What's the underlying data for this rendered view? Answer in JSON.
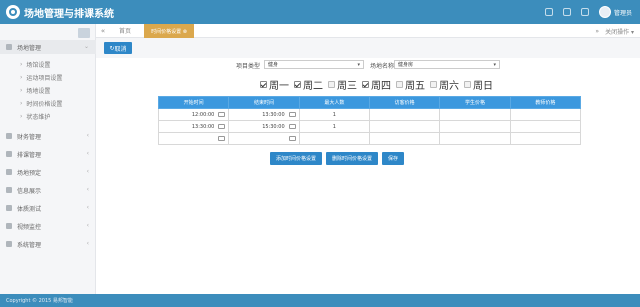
{
  "app": {
    "title": "场地管理与排课系统",
    "user": "管理员"
  },
  "topbar": {
    "icons": [
      "grid-icon",
      "bell-icon",
      "help-icon"
    ]
  },
  "tabs": {
    "home": "首页",
    "active": "时间价格设置 ⊗",
    "more": "关闭操作 ▾"
  },
  "sidebar": {
    "sections": [
      {
        "label": "场地管理",
        "icon": "venue-icon",
        "expanded": true,
        "chev": "⌄"
      },
      {
        "label": "财务管理",
        "icon": "money-icon",
        "chev": "‹"
      },
      {
        "label": "排课管理",
        "icon": "schedule-icon",
        "chev": "‹"
      },
      {
        "label": "场地预定",
        "icon": "check-icon",
        "chev": "‹"
      },
      {
        "label": "信息展示",
        "icon": "info-icon",
        "chev": "‹"
      },
      {
        "label": "体质测试",
        "icon": "heart-icon",
        "chev": "‹"
      },
      {
        "label": "视频监控",
        "icon": "video-icon",
        "chev": "‹"
      },
      {
        "label": "系统管理",
        "icon": "gear-icon",
        "chev": "‹"
      }
    ],
    "sub": [
      "场馆设置",
      "运动项目设置",
      "场地设置",
      "时间价格设置",
      "状态维护"
    ]
  },
  "toolbar": {
    "cancel": "取消"
  },
  "form": {
    "project_label": "项目类型",
    "project_value": "健身",
    "venue_label": "场地名称",
    "venue_value": "健身房",
    "arrow": "▾"
  },
  "weekdays": [
    {
      "label": "周一",
      "checked": true
    },
    {
      "label": "周二",
      "checked": true
    },
    {
      "label": "周三",
      "checked": false
    },
    {
      "label": "周四",
      "checked": true
    },
    {
      "label": "周五",
      "checked": false
    },
    {
      "label": "周六",
      "checked": false
    },
    {
      "label": "周日",
      "checked": false
    }
  ],
  "table": {
    "headers": [
      "开始时间",
      "结束时间",
      "最大人数",
      "访客价格",
      "学生价格",
      "教师价格"
    ],
    "rows": [
      {
        "start": "12:00:00",
        "end": "13:30:00",
        "max": "1",
        "visitor": "",
        "student": "",
        "teacher": ""
      },
      {
        "start": "13:30:00",
        "end": "15:30:00",
        "max": "1",
        "visitor": "",
        "student": "",
        "teacher": ""
      },
      {
        "start": "",
        "end": "",
        "max": "",
        "visitor": "",
        "student": "",
        "teacher": ""
      }
    ]
  },
  "actions": {
    "add": "添加时间价格设置",
    "delete": "删除时间价格设置",
    "save": "保存"
  },
  "footer": {
    "text": "Copyright © 2015 易邦智能"
  },
  "colors": {
    "primary": "#3c8dbc",
    "button": "#2e87c8",
    "tab_active": "#dba84d",
    "header": "#3c98de"
  }
}
